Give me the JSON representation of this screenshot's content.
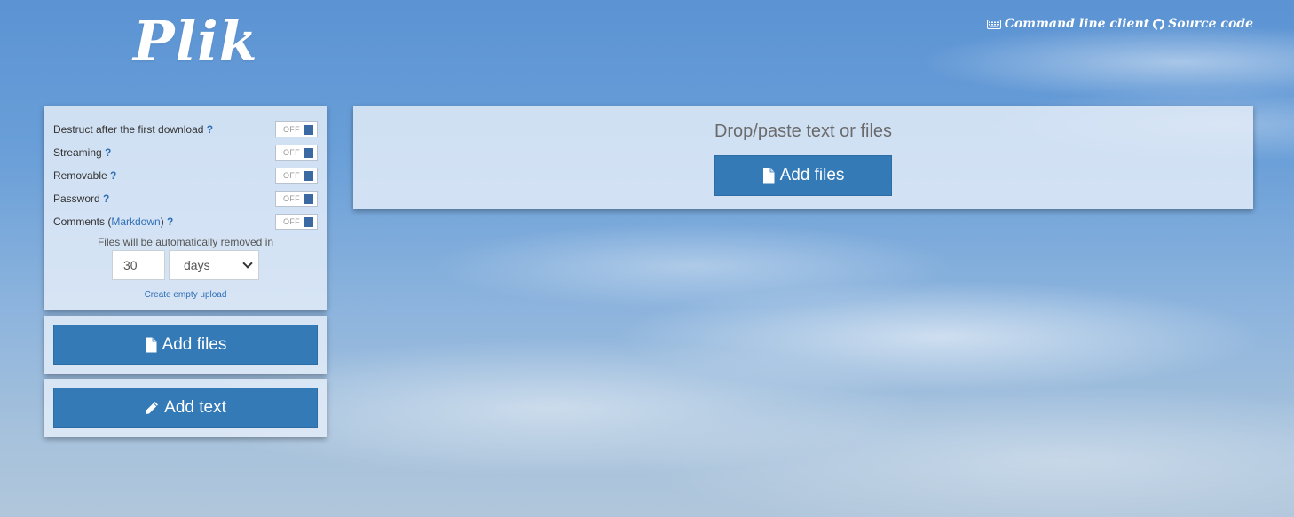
{
  "app": {
    "logo": "Plik"
  },
  "header": {
    "links": [
      {
        "label": "Command line client",
        "icon": "keyboard-icon"
      },
      {
        "label": "Source code",
        "icon": "github-icon"
      }
    ]
  },
  "settings": {
    "options": [
      {
        "label": "Destruct after the first download",
        "help": "?",
        "state": "OFF"
      },
      {
        "label": "Streaming",
        "help": "?",
        "state": "OFF"
      },
      {
        "label": "Removable",
        "help": "?",
        "state": "OFF"
      },
      {
        "label": "Password",
        "help": "?",
        "state": "OFF"
      },
      {
        "label_prefix": "Comments (",
        "link": "Markdown",
        "label_suffix": ")",
        "help": "?",
        "state": "OFF"
      }
    ],
    "expire_text": "Files will be automatically removed in",
    "ttl_value": "30",
    "ttl_unit": "days",
    "empty_upload_label": "Create empty upload"
  },
  "actions": {
    "add_files_label": "Add files",
    "add_text_label": "Add text"
  },
  "drop_zone": {
    "title": "Drop/paste text or files",
    "add_files_label": "Add files"
  },
  "colors": {
    "primary_button": "#337ab7",
    "toggle_knob": "#3b6aa3",
    "link": "#2f6fb5"
  }
}
